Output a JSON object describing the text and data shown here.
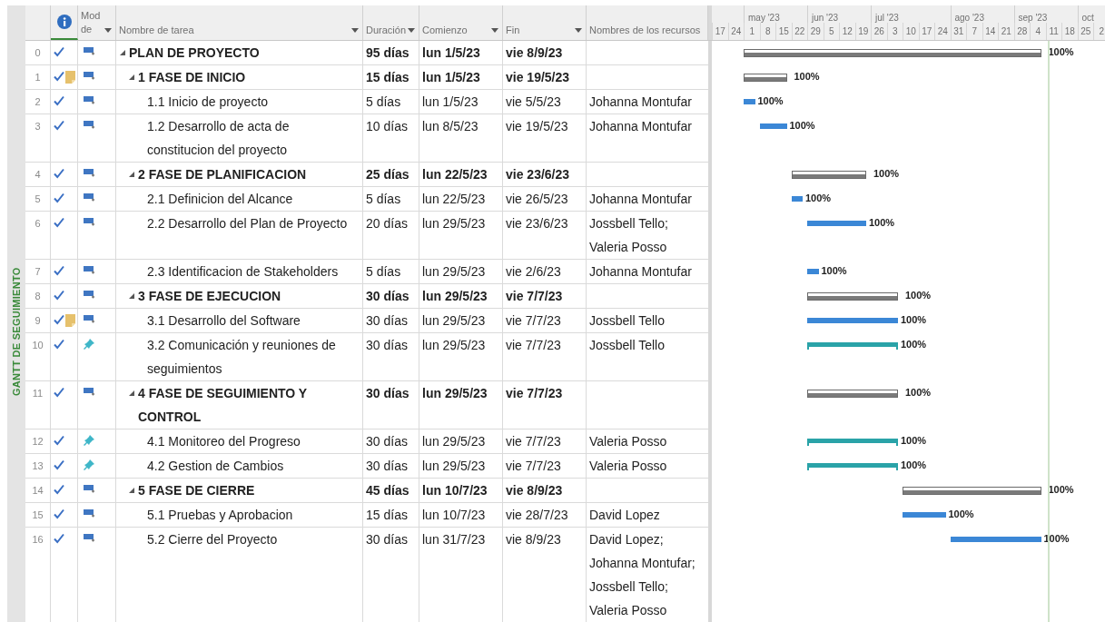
{
  "side_label": "GANTT DE SEGUIMIENTO",
  "columns": [
    {
      "label": "Mod de",
      "dropdown": true
    },
    {
      "label": "Nombre de tarea",
      "dropdown": true
    },
    {
      "label": "Duración",
      "dropdown": true
    },
    {
      "label": "Comienzo",
      "dropdown": true
    },
    {
      "label": "Fin",
      "dropdown": true
    },
    {
      "label": "Nombres de los recursos",
      "dropdown": false
    }
  ],
  "timescale": {
    "months": [
      "may '23",
      "jun '23",
      "jul '23",
      "ago '23",
      "sep '23",
      "oct"
    ],
    "weeks": [
      "17",
      "24",
      "1",
      "8",
      "15",
      "22",
      "29",
      "5",
      "12",
      "19",
      "26",
      "3",
      "10",
      "17",
      "24",
      "31",
      "7",
      "14",
      "21",
      "28",
      "4",
      "11",
      "18",
      "25",
      "2"
    ]
  },
  "tasks": [
    {
      "id": "0",
      "done": true,
      "note": false,
      "manual": false,
      "kind": "summary",
      "expanded": true,
      "name": "PLAN DE PROYECTO",
      "duration": "95 días",
      "start": "lun 1/5/23",
      "end": "vie 8/9/23",
      "progress": "100%",
      "children": [
        {
          "id": "1",
          "done": true,
          "note": true,
          "manual": false,
          "kind": "summary",
          "expanded": true,
          "name": "1 FASE DE INICIO",
          "duration": "15 días",
          "start": "lun 1/5/23",
          "end": "vie 19/5/23",
          "progress": "100%",
          "children": [
            {
              "id": "2",
              "done": true,
              "note": false,
              "manual": false,
              "kind": "task",
              "name": "1.1 Inicio de proyecto",
              "duration": "5 días",
              "start": "lun 1/5/23",
              "end": "vie 5/5/23",
              "resources": "Johanna Montufar",
              "progress": "100%"
            },
            {
              "id": "3",
              "done": true,
              "note": false,
              "manual": false,
              "kind": "task",
              "name": "1.2 Desarrollo de acta de constitucion del proyecto",
              "duration": "10 días",
              "start": "lun 8/5/23",
              "end": "vie 19/5/23",
              "resources": "Johanna Montufar",
              "progress": "100%"
            }
          ]
        },
        {
          "id": "4",
          "done": true,
          "note": false,
          "manual": false,
          "kind": "summary",
          "expanded": true,
          "name": "2 FASE DE PLANIFICACION",
          "duration": "25 días",
          "start": "lun 22/5/23",
          "end": "vie 23/6/23",
          "progress": "100%",
          "children": [
            {
              "id": "5",
              "done": true,
              "note": false,
              "manual": false,
              "kind": "task",
              "name": "2.1 Definicion del Alcance",
              "duration": "5 días",
              "start": "lun 22/5/23",
              "end": "vie 26/5/23",
              "resources": "Johanna Montufar",
              "progress": "100%"
            },
            {
              "id": "6",
              "done": true,
              "note": false,
              "manual": false,
              "kind": "task",
              "name": "2.2 Desarrollo del Plan de Proyecto",
              "duration": "20 días",
              "start": "lun 29/5/23",
              "end": "vie 23/6/23",
              "resources": "Jossbell Tello; Valeria Posso",
              "progress": "100%"
            },
            {
              "id": "7",
              "done": true,
              "note": false,
              "manual": false,
              "kind": "task",
              "name": "2.3 Identificacion de Stakeholders",
              "duration": "5 días",
              "start": "lun 29/5/23",
              "end": "vie 2/6/23",
              "resources": "Johanna Montufar",
              "progress": "100%"
            }
          ]
        },
        {
          "id": "8",
          "done": true,
          "note": false,
          "manual": false,
          "kind": "summary",
          "expanded": true,
          "name": "3 FASE DE EJECUCION",
          "duration": "30 días",
          "start": "lun 29/5/23",
          "end": "vie 7/7/23",
          "progress": "100%",
          "children": [
            {
              "id": "9",
              "done": true,
              "note": true,
              "manual": false,
              "kind": "task",
              "name": "3.1 Desarrollo del Software",
              "duration": "30 días",
              "start": "lun 29/5/23",
              "end": "vie 7/7/23",
              "resources": "Jossbell Tello",
              "progress": "100%"
            },
            {
              "id": "10",
              "done": true,
              "note": false,
              "manual": true,
              "kind": "task",
              "name": "3.2 Comunicación y reuniones de seguimientos",
              "duration": "30 días",
              "start": "lun 29/5/23",
              "end": "vie 7/7/23",
              "resources": "Jossbell Tello",
              "progress": "100%"
            }
          ]
        },
        {
          "id": "11",
          "done": true,
          "note": false,
          "manual": false,
          "kind": "summary",
          "expanded": true,
          "name": "4 FASE DE SEGUIMIENTO Y CONTROL",
          "duration": "30 días",
          "start": "lun 29/5/23",
          "end": "vie 7/7/23",
          "progress": "100%",
          "children": [
            {
              "id": "12",
              "done": true,
              "note": false,
              "manual": true,
              "kind": "task",
              "name": "4.1 Monitoreo del Progreso",
              "duration": "30 días",
              "start": "lun 29/5/23",
              "end": "vie 7/7/23",
              "resources": "Valeria Posso",
              "progress": "100%"
            },
            {
              "id": "13",
              "done": true,
              "note": false,
              "manual": true,
              "kind": "task",
              "name": "4.2 Gestion de Cambios",
              "duration": "30 días",
              "start": "lun 29/5/23",
              "end": "vie 7/7/23",
              "resources": "Valeria Posso",
              "progress": "100%"
            }
          ]
        },
        {
          "id": "14",
          "done": true,
          "note": false,
          "manual": false,
          "kind": "summary",
          "expanded": true,
          "name": "5 FASE DE CIERRE",
          "duration": "45 días",
          "start": "lun 10/7/23",
          "end": "vie 8/9/23",
          "progress": "100%",
          "children": [
            {
              "id": "15",
              "done": true,
              "note": false,
              "manual": false,
              "kind": "task",
              "name": "5.1 Pruebas y Aprobacion",
              "duration": "15 días",
              "start": "lun 10/7/23",
              "end": "vie 28/7/23",
              "resources": "David Lopez",
              "progress": "100%"
            },
            {
              "id": "16",
              "done": true,
              "note": false,
              "manual": false,
              "kind": "task",
              "name": "5.2 Cierre del Proyecto",
              "duration": "30 días",
              "start": "lun 31/7/23",
              "end": "vie 8/9/23",
              "resources": "David Lopez; Johanna Montufar; Jossbell Tello; Valeria Posso",
              "progress": "100%"
            }
          ]
        }
      ]
    }
  ]
}
